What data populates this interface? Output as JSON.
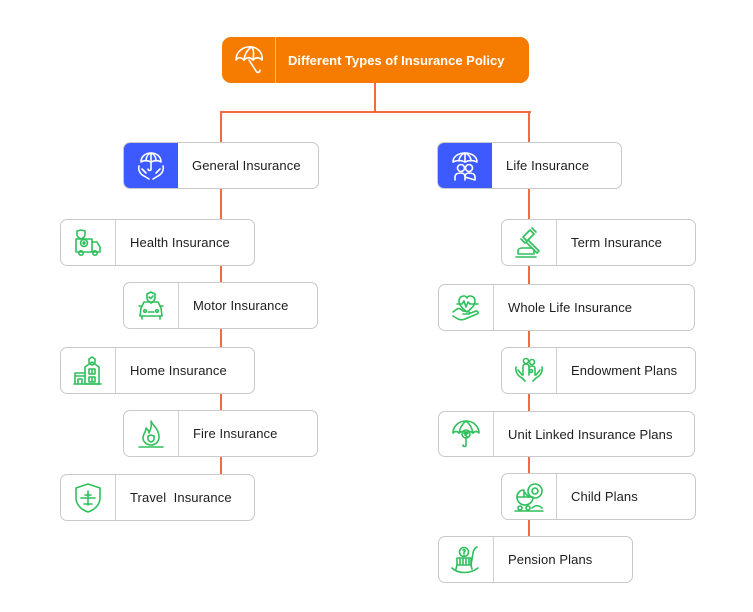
{
  "root": {
    "label": "Different Types of Insurance Policy",
    "icon": "umbrella-icon",
    "color": "#f57c00"
  },
  "connector_color": "#f26a3d",
  "categories": [
    {
      "label": "General Insurance",
      "icon": "umbrella-hands-icon",
      "color": "#3d5afe",
      "items": [
        {
          "label": "Health Insurance",
          "icon": "ambulance-icon"
        },
        {
          "label": "Motor Insurance",
          "icon": "car-shield-icon"
        },
        {
          "label": "Home Insurance",
          "icon": "house-shield-icon"
        },
        {
          "label": "Fire Insurance",
          "icon": "fire-shield-icon"
        },
        {
          "label": "Travel  Insurance",
          "icon": "plane-shield-icon"
        }
      ]
    },
    {
      "label": "Life Insurance",
      "icon": "umbrella-people-icon",
      "color": "#3d5afe",
      "items": [
        {
          "label": "Term Insurance",
          "icon": "gavel-icon"
        },
        {
          "label": "Whole Life Insurance",
          "icon": "heart-hand-icon"
        },
        {
          "label": "Endowment Plans",
          "icon": "family-hands-icon"
        },
        {
          "label": "Unit Linked Insurance Plans",
          "icon": "rupee-umbrella-icon"
        },
        {
          "label": "Child Plans",
          "icon": "baby-stroller-icon"
        },
        {
          "label": "Pension Plans",
          "icon": "rocking-chair-icon"
        }
      ]
    }
  ],
  "icon_color": "#2fbf5b"
}
